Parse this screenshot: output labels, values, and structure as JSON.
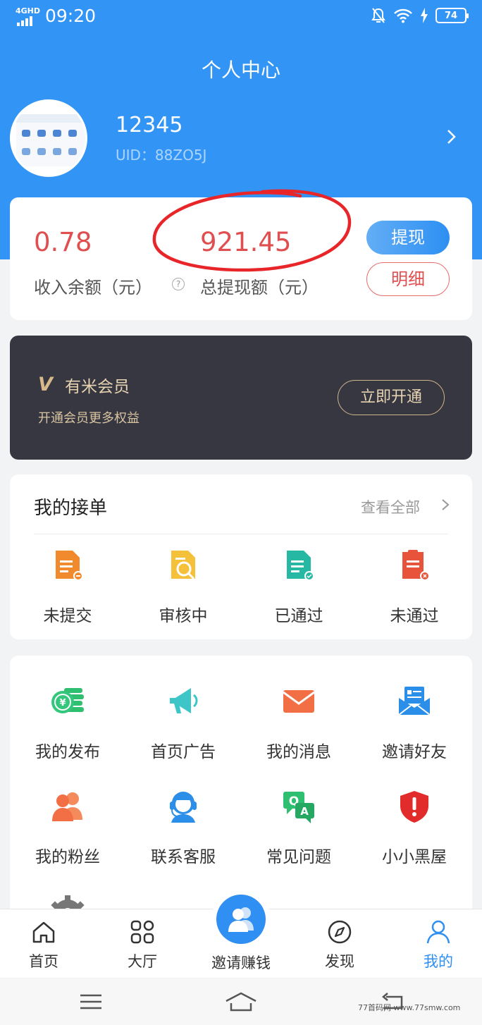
{
  "status_bar": {
    "network": "4GHD",
    "time": "09:20",
    "battery": "74"
  },
  "header": {
    "title": "个人中心"
  },
  "user": {
    "name": "12345",
    "uid": "UID：88ZO5J"
  },
  "balance": {
    "income_value": "0.78",
    "income_label": "收入余额（元）",
    "help_icon": "?",
    "total_value": "921.45",
    "total_label": "总提现额（元）",
    "withdraw_label": "提现",
    "detail_label": "明细"
  },
  "vip": {
    "logo": "V",
    "title": "有米会员",
    "subtitle": "开通会员更多权益",
    "button": "立即开通"
  },
  "orders": {
    "title": "我的接单",
    "view_all": "查看全部",
    "items": [
      {
        "label": "未提交",
        "icon": "doc-pending-icon"
      },
      {
        "label": "审核中",
        "icon": "doc-search-icon"
      },
      {
        "label": "已通过",
        "icon": "doc-approved-icon"
      },
      {
        "label": "未通过",
        "icon": "doc-rejected-icon"
      }
    ]
  },
  "tools": [
    {
      "label": "我的发布",
      "icon": "coins-icon"
    },
    {
      "label": "首页广告",
      "icon": "megaphone-icon"
    },
    {
      "label": "我的消息",
      "icon": "mail-icon"
    },
    {
      "label": "邀请好友",
      "icon": "invite-letter-icon"
    },
    {
      "label": "我的粉丝",
      "icon": "fans-icon"
    },
    {
      "label": "联系客服",
      "icon": "customer-service-icon"
    },
    {
      "label": "常见问题",
      "icon": "qa-icon"
    },
    {
      "label": "小小黑屋",
      "icon": "shield-alert-icon"
    }
  ],
  "tabbar": {
    "items": [
      {
        "label": "首页",
        "icon": "home-icon"
      },
      {
        "label": "大厅",
        "icon": "grid-icon"
      },
      {
        "label": "邀请赚钱",
        "icon": "users-icon"
      },
      {
        "label": "发现",
        "icon": "compass-icon"
      },
      {
        "label": "我的",
        "icon": "person-icon"
      }
    ],
    "active": "我的"
  },
  "colors": {
    "primary": "#3295f5",
    "accent_red": "#e04f4f",
    "vip_bg": "#363741",
    "vip_gold": "#d8b98a"
  },
  "watermark": "77首码网 www.77smw.com"
}
